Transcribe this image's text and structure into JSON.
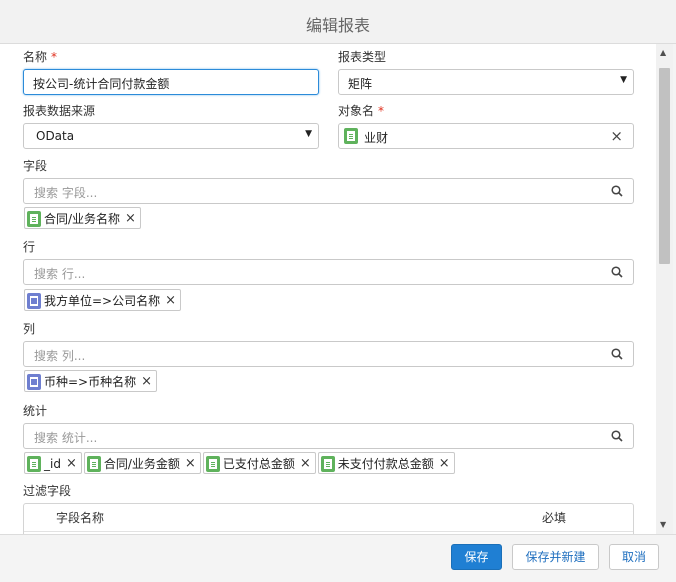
{
  "dialog": {
    "title": "编辑报表"
  },
  "form": {
    "name": {
      "label": "名称",
      "required_mark": "*",
      "value": "按公司-统计合同付款金额"
    },
    "report_type": {
      "label": "报表类型",
      "value": "矩阵"
    },
    "data_source": {
      "label": "报表数据来源",
      "value": "OData"
    },
    "object_name": {
      "label": "对象名",
      "required_mark": "*",
      "value": "业财"
    },
    "fields": {
      "label": "字段",
      "placeholder": "搜索 字段...",
      "chips": [
        {
          "label": "合同/业务名称",
          "icon": "doc-icon"
        }
      ]
    },
    "rows": {
      "label": "行",
      "placeholder": "搜索 行...",
      "chips": [
        {
          "label": "我方单位=>公司名称",
          "icon": "reference-icon"
        }
      ]
    },
    "columns": {
      "label": "列",
      "placeholder": "搜索 列...",
      "chips": [
        {
          "label": "币种=>币种名称",
          "icon": "reference-icon"
        }
      ]
    },
    "stats": {
      "label": "统计",
      "placeholder": "搜索 统计...",
      "chips": [
        {
          "label": "_id",
          "icon": "doc-icon"
        },
        {
          "label": "合同/业务金额",
          "icon": "doc-icon"
        },
        {
          "label": "已支付总金额",
          "icon": "doc-icon"
        },
        {
          "label": "未支付付款总金额",
          "icon": "doc-icon"
        }
      ]
    },
    "filter_fields": {
      "label": "过滤字段",
      "columns": [
        "字段名称",
        "必填"
      ]
    }
  },
  "footer": {
    "save_label": "保存",
    "save_new_label": "保存并新建",
    "cancel_label": "取消"
  },
  "colors": {
    "primary": "#1f7fd3",
    "field_icon": "#5fb25c",
    "reference_icon": "#6f7fd0",
    "required": "#e0301e"
  }
}
